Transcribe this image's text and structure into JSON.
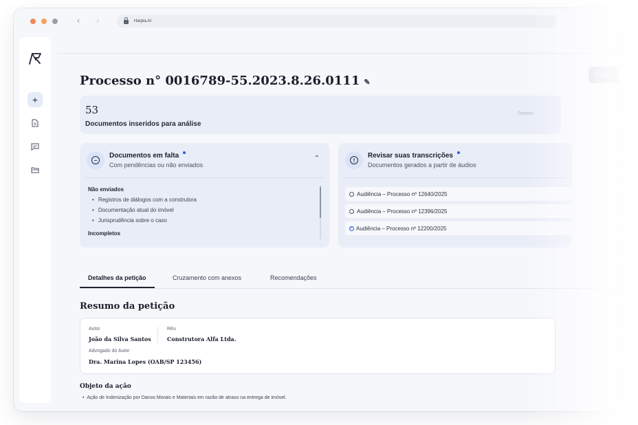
{
  "browser": {
    "url": "Harpia.AI",
    "back_icon": "chevron-left-icon",
    "forward_icon": "chevron-right-icon"
  },
  "sidebar": {
    "logo_icon": "harpia-logo-icon",
    "items": [
      {
        "name": "new-icon",
        "glyph": "+"
      },
      {
        "name": "document-icon",
        "glyph": "doc"
      },
      {
        "name": "chat-icon",
        "glyph": "chat"
      },
      {
        "name": "folder-icon",
        "glyph": "folder"
      }
    ]
  },
  "header": {
    "title": "Processo n° 0016789-55.2023.8.26.0111",
    "edit_icon": "pencil-icon",
    "finalize_label": "Finaliz"
  },
  "stats": {
    "count": "53",
    "label": "Documentos inseridos para análise",
    "right_text": "Gerenc"
  },
  "missing_docs": {
    "title": "Documentos em falta",
    "subtitle": "Com pendências ou não enviados",
    "groups": [
      {
        "heading": "Não enviados",
        "items": [
          "Registros de diálogos com a construtora",
          "Documentação atual do imóvel",
          "Jurisprudência sobre o caso"
        ]
      },
      {
        "heading": "Incompletos",
        "items": []
      }
    ]
  },
  "transcriptions": {
    "title": "Revisar suas transcrições",
    "subtitle": "Documentos gerados a partir de áudios",
    "items": [
      {
        "label": "Audiência – Processo nº 12640/2025",
        "checked": false
      },
      {
        "label": "Audiência – Processo nº 12396/2025",
        "checked": false
      },
      {
        "label": "Audiência – Processo nº 12200/2025",
        "checked": true
      }
    ]
  },
  "tabs": [
    {
      "label": "Detalhes da petição",
      "active": true
    },
    {
      "label": "Cruzamento com anexos",
      "active": false
    },
    {
      "label": "Recomendações",
      "active": false
    }
  ],
  "summary": {
    "title": "Resumo da petição",
    "author_label": "Autor",
    "author_value": "João da Silva Santos",
    "defendant_label": "Réu",
    "defendant_value": "Construtora Alfa Ltda.",
    "lawyer_label": "Advogado do Autor",
    "lawyer_value": "Dra. Marina Lopes (OAB/SP 123456)"
  },
  "objeto": {
    "title": "Objeto da ação",
    "items": [
      "Ação de Indenização por Danos Morais e Materiais em razão de atraso na entrega de imóvel."
    ]
  },
  "colors": {
    "accent": "#2f5be0",
    "panel_bg": "#e9edf7",
    "page_bg": "#f6f7fb"
  }
}
